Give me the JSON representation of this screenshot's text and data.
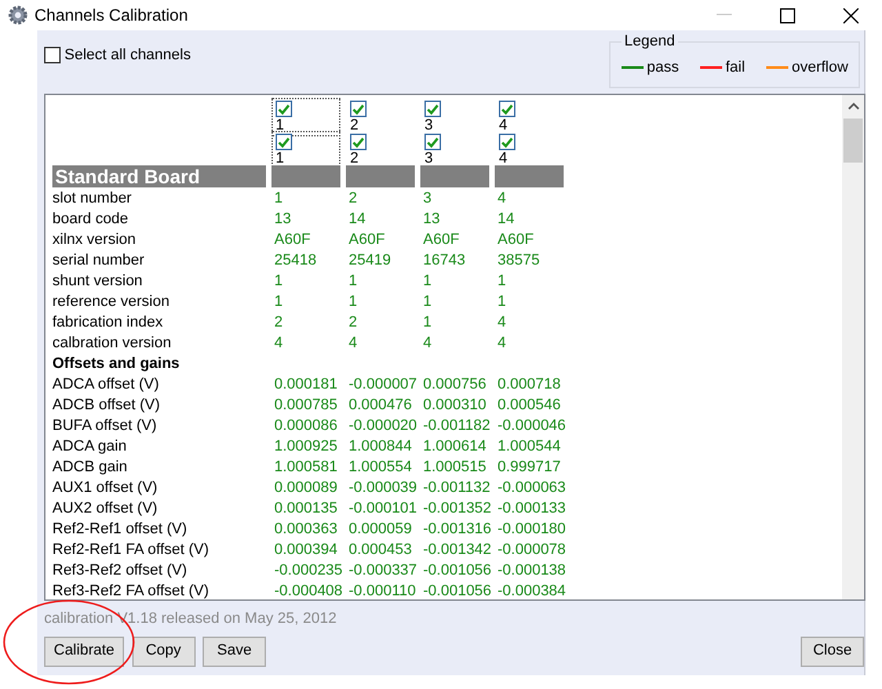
{
  "window": {
    "title": "Channels Calibration"
  },
  "select_all": {
    "label": "Select all channels",
    "checked": false
  },
  "legend": {
    "title": "Legend",
    "items": [
      {
        "label": "pass",
        "color": "#1a8a1a"
      },
      {
        "label": "fail",
        "color": "#ff2020"
      },
      {
        "label": "overflow",
        "color": "#ff8c1a"
      }
    ]
  },
  "channel_rows": [
    [
      {
        "label": "1",
        "checked": true,
        "focused": true
      },
      {
        "label": "2",
        "checked": true,
        "focused": false
      },
      {
        "label": "3",
        "checked": true,
        "focused": false
      },
      {
        "label": "4",
        "checked": true,
        "focused": false
      }
    ],
    [
      {
        "label": "1",
        "checked": true,
        "focused": true
      },
      {
        "label": "2",
        "checked": true,
        "focused": false
      },
      {
        "label": "3",
        "checked": true,
        "focused": false
      },
      {
        "label": "4",
        "checked": true,
        "focused": false
      }
    ]
  ],
  "table": {
    "rows": [
      {
        "kind": "banner",
        "label": "Standard Board"
      },
      {
        "kind": "row",
        "label": "slot number",
        "color": "#1a8a1a",
        "values": [
          "1",
          "2",
          "3",
          "4"
        ]
      },
      {
        "kind": "row",
        "label": "board code",
        "color": "#1a8a1a",
        "values": [
          "13",
          "14",
          "13",
          "14"
        ]
      },
      {
        "kind": "row",
        "label": "xilnx version",
        "color": "#1a8a1a",
        "values": [
          "A60F",
          "A60F",
          "A60F",
          "A60F"
        ]
      },
      {
        "kind": "row",
        "label": "serial number",
        "color": "#1a8a1a",
        "values": [
          "25418",
          "25419",
          "16743",
          "38575"
        ]
      },
      {
        "kind": "row",
        "label": "shunt version",
        "color": "#1a8a1a",
        "values": [
          "1",
          "1",
          "1",
          "1"
        ]
      },
      {
        "kind": "row",
        "label": "reference version",
        "color": "#1a8a1a",
        "values": [
          "1",
          "1",
          "1",
          "1"
        ]
      },
      {
        "kind": "row",
        "label": "fabrication index",
        "color": "#1a8a1a",
        "values": [
          "2",
          "2",
          "1",
          "4"
        ]
      },
      {
        "kind": "row",
        "label": "calbration version",
        "color": "#1a8a1a",
        "values": [
          "4",
          "4",
          "4",
          "4"
        ]
      },
      {
        "kind": "heading",
        "label": "Offsets and gains"
      },
      {
        "kind": "row",
        "label": "ADCA offset (V)",
        "color": "#1a8a1a",
        "values": [
          "0.000181",
          "-0.000007",
          "0.000756",
          "0.000718"
        ]
      },
      {
        "kind": "row",
        "label": "ADCB offset (V)",
        "color": "#1a8a1a",
        "values": [
          "0.000785",
          "0.000476",
          "0.000310",
          "0.000546"
        ]
      },
      {
        "kind": "row",
        "label": "BUFA offset (V)",
        "color": "#1a8a1a",
        "values": [
          "0.000086",
          "-0.000020",
          "-0.001182",
          "-0.000046"
        ]
      },
      {
        "kind": "row",
        "label": "ADCA gain",
        "color": "#1a8a1a",
        "values": [
          "1.000925",
          "1.000844",
          "1.000614",
          "1.000544"
        ]
      },
      {
        "kind": "row",
        "label": "ADCB gain",
        "color": "#1a8a1a",
        "values": [
          "1.000581",
          "1.000554",
          "1.000515",
          "0.999717"
        ]
      },
      {
        "kind": "row",
        "label": "AUX1 offset (V)",
        "color": "#1a8a1a",
        "values": [
          "0.000089",
          "-0.000039",
          "-0.001132",
          "-0.000063"
        ]
      },
      {
        "kind": "row",
        "label": "AUX2 offset (V)",
        "color": "#1a8a1a",
        "values": [
          "0.000135",
          "-0.000101",
          "-0.001352",
          "-0.000133"
        ]
      },
      {
        "kind": "row",
        "label": "Ref2-Ref1 offset (V)",
        "color": "#1a8a1a",
        "values": [
          "0.000363",
          "0.000059",
          "-0.001316",
          "-0.000180"
        ]
      },
      {
        "kind": "row",
        "label": "Ref2-Ref1 FA offset (V)",
        "color": "#1a8a1a",
        "values": [
          "0.000394",
          "0.000453",
          "-0.001342",
          "-0.000078"
        ]
      },
      {
        "kind": "row",
        "label": "Ref3-Ref2 offset (V)",
        "color": "#1a8a1a",
        "values": [
          "-0.000235",
          "-0.000337",
          "-0.001056",
          "-0.000138"
        ]
      },
      {
        "kind": "row",
        "label": "Ref3-Ref2 FA offset (V)",
        "color": "#1a8a1a",
        "values": [
          "-0.000408",
          "-0.000110",
          "-0.001056",
          "-0.000384"
        ]
      }
    ]
  },
  "version_text": "calibration V1.18 released on May 25, 2012",
  "buttons_left": [
    "Calibrate",
    "Copy",
    "Save"
  ],
  "buttons_right": [
    "Close"
  ]
}
